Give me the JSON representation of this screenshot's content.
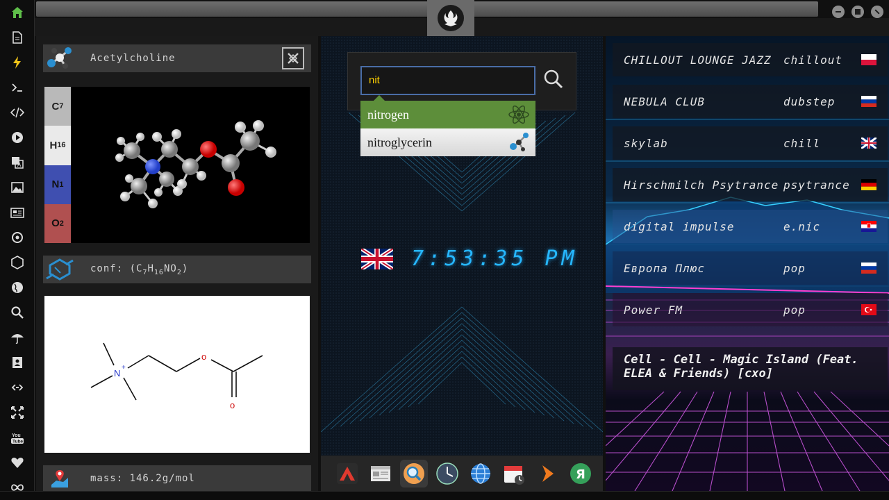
{
  "rail": {
    "icons": [
      "home-icon",
      "document-icon",
      "bolt-icon",
      "terminal-icon",
      "code-icon",
      "play-icon",
      "translate-icon",
      "image-icon",
      "news-icon",
      "settings-icon",
      "hexagon-icon",
      "globe-icon",
      "search-icon",
      "umbrella-icon",
      "contact-icon",
      "link-icon",
      "fullscreen-icon",
      "youtube-icon",
      "heart-icon",
      "infinity-icon"
    ],
    "youtube_label": "You Tube"
  },
  "molecule": {
    "name": "Acetylcholine",
    "formula": [
      {
        "el": "C",
        "n": "7",
        "color": "#b9b9b9",
        "text": "#222"
      },
      {
        "el": "H",
        "n": "16",
        "color": "#eaeaea",
        "text": "#222"
      },
      {
        "el": "N",
        "n": "1",
        "color": "#3f4fb0",
        "text": "#111"
      },
      {
        "el": "O",
        "n": "2",
        "color": "#b05050",
        "text": "#111"
      }
    ],
    "conf_label": "conf: (C",
    "conf_parts": [
      "conf: (C",
      "7",
      "H",
      "16",
      "NO",
      "2",
      ")"
    ],
    "mass": "mass: 146.2g/mol",
    "structure_labels": {
      "n": "N",
      "charge": "+",
      "o1": "o",
      "o2": "o"
    }
  },
  "search": {
    "value": "nit",
    "suggestions": [
      {
        "label": "nitrogen",
        "icon": "atom-icon",
        "selected": true
      },
      {
        "label": "nitroglycerin",
        "icon": "molecule-icon",
        "selected": false
      }
    ]
  },
  "clock": {
    "time": "7:53:35 PM",
    "flag": "uk-flag-icon"
  },
  "dock": [
    "adobe-icon",
    "news-reader-icon",
    "search-app-icon",
    "clock-app-icon",
    "browser-icon",
    "calendar-icon",
    "media-player-icon",
    "yandex-icon"
  ],
  "stations": [
    {
      "name": "CHILLOUT LOUNGE JAZZ",
      "genre": "chillout",
      "flag": "poland"
    },
    {
      "name": "NEBULA CLUB",
      "genre": "dubstep",
      "flag": "russia"
    },
    {
      "name": "skylab",
      "genre": "chill",
      "flag": "uk"
    },
    {
      "name": "Hirschmilch Psytrance",
      "genre": "psytrance",
      "flag": "germany"
    },
    {
      "name": "digital impulse",
      "genre": "e.nic",
      "flag": "croatia"
    },
    {
      "name": "Европа Плюс",
      "genre": "pop",
      "flag": "russia"
    },
    {
      "name": "Power FM",
      "genre": "pop",
      "flag": "turkey"
    }
  ],
  "now_playing": "Cell - Cell - Magic Island (Feat. ELEA & Friends) [cxo]",
  "colors": {
    "accent": "#26b7ff",
    "search_text": "#ffd000",
    "suggest_selected": "#5d8e3a",
    "rail_home": "#5fbf4a",
    "rail_bolt": "#f0c419"
  }
}
